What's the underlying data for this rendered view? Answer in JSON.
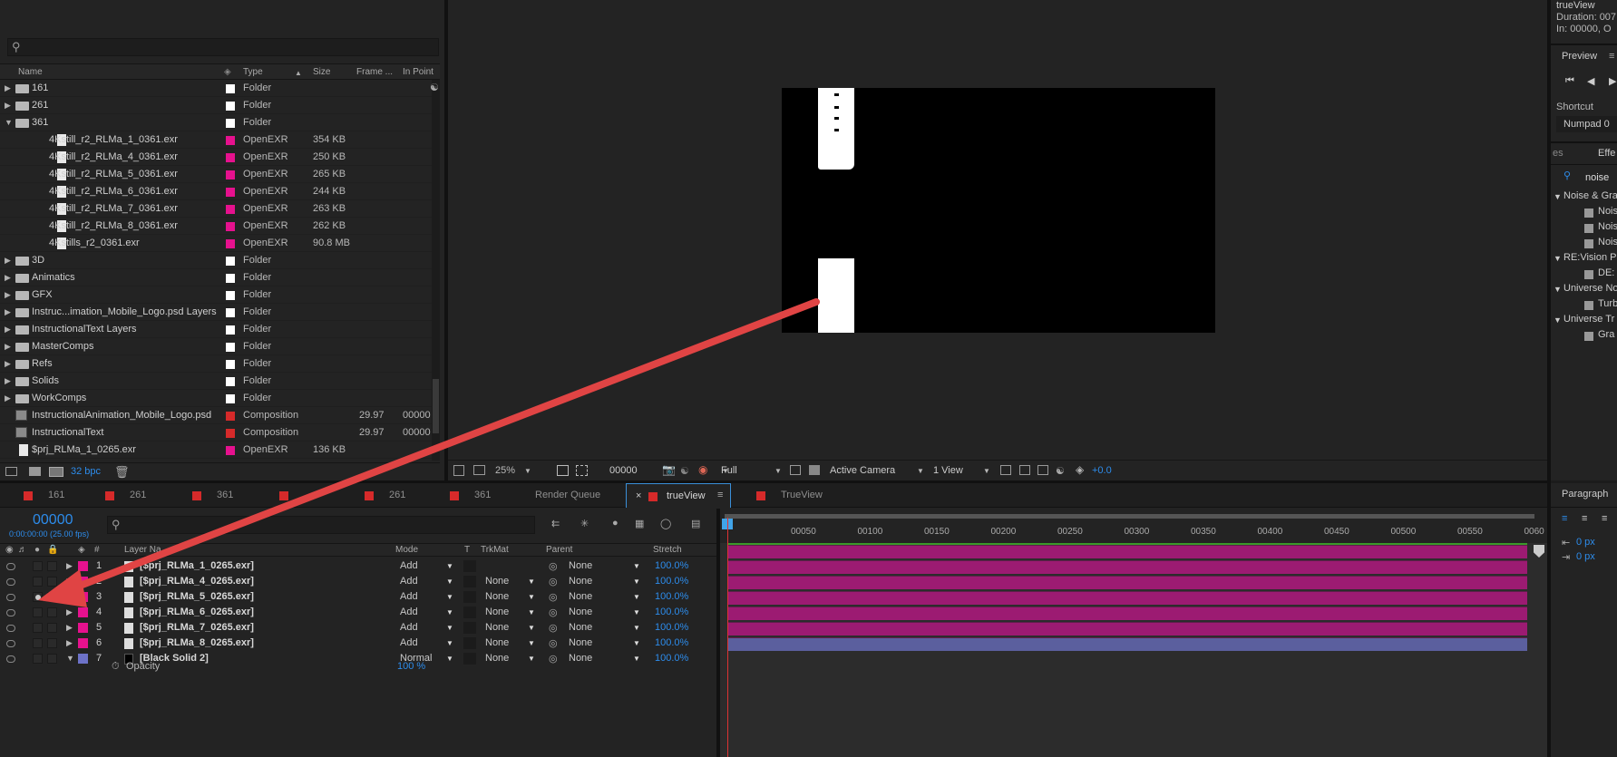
{
  "colors": {
    "accent_blue": "#2d8ceb",
    "label_pink": "#e6118e",
    "label_red": "#d62a2a",
    "label_white": "#ffffff",
    "label_purple": "#6d72c8",
    "clip_magenta": "#9c1b72",
    "clip_purple": "#5b5f9e",
    "annotation_arrow": "#e04444"
  },
  "right_panel": {
    "comp_name": "trueView",
    "duration": "Duration: 007",
    "in_point": "In: 00000, O",
    "preview_title": "Preview",
    "shortcut_label": "Shortcut",
    "shortcut_value": "Numpad 0",
    "effects_tab_left": "es",
    "effects_tab_right": "Effe",
    "effects_search": "noise",
    "effects_tree": [
      {
        "label": "Noise & Gra",
        "kind": "group"
      },
      {
        "label": "Nois",
        "kind": "item"
      },
      {
        "label": "Nois",
        "kind": "item"
      },
      {
        "label": "Nois",
        "kind": "item"
      },
      {
        "label": "RE:Vision Pl",
        "kind": "group"
      },
      {
        "label": "DE:",
        "kind": "item"
      },
      {
        "label": "Universe No",
        "kind": "group"
      },
      {
        "label": "Turb",
        "kind": "item"
      },
      {
        "label": "Universe Tr",
        "kind": "group"
      },
      {
        "label": "Gra",
        "kind": "item"
      }
    ],
    "paragraph_title": "Paragraph",
    "para_val1": "0 px",
    "para_val2": "0 px"
  },
  "project": {
    "headers": {
      "name": "Name",
      "type": "Type",
      "size": "Size",
      "frame": "Frame ...",
      "in_point": "In Point"
    },
    "rows": [
      {
        "indent": 0,
        "kind": "folder",
        "open": false,
        "name": "161",
        "label": "white",
        "type": "Folder",
        "size": "",
        "frame": "",
        "inpt": ""
      },
      {
        "indent": 0,
        "kind": "folder",
        "open": false,
        "name": "261",
        "label": "white",
        "type": "Folder",
        "size": "",
        "frame": "",
        "inpt": ""
      },
      {
        "indent": 0,
        "kind": "folder",
        "open": true,
        "name": "361",
        "label": "white",
        "type": "Folder",
        "size": "",
        "frame": "",
        "inpt": ""
      },
      {
        "indent": 1,
        "kind": "file",
        "name": "4Kstill_r2_RLMa_1_0361.exr",
        "label": "pink",
        "type": "OpenEXR",
        "size": "354 KB",
        "frame": "",
        "inpt": ""
      },
      {
        "indent": 1,
        "kind": "file",
        "name": "4Kstill_r2_RLMa_4_0361.exr",
        "label": "pink",
        "type": "OpenEXR",
        "size": "250 KB",
        "frame": "",
        "inpt": ""
      },
      {
        "indent": 1,
        "kind": "file",
        "name": "4Kstill_r2_RLMa_5_0361.exr",
        "label": "pink",
        "type": "OpenEXR",
        "size": "265 KB",
        "frame": "",
        "inpt": ""
      },
      {
        "indent": 1,
        "kind": "file",
        "name": "4Kstill_r2_RLMa_6_0361.exr",
        "label": "pink",
        "type": "OpenEXR",
        "size": "244 KB",
        "frame": "",
        "inpt": ""
      },
      {
        "indent": 1,
        "kind": "file",
        "name": "4Kstill_r2_RLMa_7_0361.exr",
        "label": "pink",
        "type": "OpenEXR",
        "size": "263 KB",
        "frame": "",
        "inpt": ""
      },
      {
        "indent": 1,
        "kind": "file",
        "name": "4Kstill_r2_RLMa_8_0361.exr",
        "label": "pink",
        "type": "OpenEXR",
        "size": "262 KB",
        "frame": "",
        "inpt": ""
      },
      {
        "indent": 1,
        "kind": "file",
        "name": "4Kstills_r2_0361.exr",
        "label": "pink",
        "type": "OpenEXR",
        "size": "90.8 MB",
        "frame": "",
        "inpt": ""
      },
      {
        "indent": 0,
        "kind": "folder",
        "open": false,
        "name": "3D",
        "label": "white",
        "type": "Folder",
        "size": "",
        "frame": "",
        "inpt": ""
      },
      {
        "indent": 0,
        "kind": "folder",
        "open": false,
        "name": "Animatics",
        "label": "white",
        "type": "Folder",
        "size": "",
        "frame": "",
        "inpt": ""
      },
      {
        "indent": 0,
        "kind": "folder",
        "open": false,
        "name": "GFX",
        "label": "white",
        "type": "Folder",
        "size": "",
        "frame": "",
        "inpt": ""
      },
      {
        "indent": 0,
        "kind": "folder",
        "open": false,
        "name": "Instruc...imation_Mobile_Logo.psd Layers",
        "label": "white",
        "type": "Folder",
        "size": "",
        "frame": "",
        "inpt": ""
      },
      {
        "indent": 0,
        "kind": "folder",
        "open": false,
        "name": "InstructionalText Layers",
        "label": "white",
        "type": "Folder",
        "size": "",
        "frame": "",
        "inpt": ""
      },
      {
        "indent": 0,
        "kind": "folder",
        "open": false,
        "name": "MasterComps",
        "label": "white",
        "type": "Folder",
        "size": "",
        "frame": "",
        "inpt": ""
      },
      {
        "indent": 0,
        "kind": "folder",
        "open": false,
        "name": "Refs",
        "label": "white",
        "type": "Folder",
        "size": "",
        "frame": "",
        "inpt": ""
      },
      {
        "indent": 0,
        "kind": "folder",
        "open": false,
        "name": "Solids",
        "label": "white",
        "type": "Folder",
        "size": "",
        "frame": "",
        "inpt": ""
      },
      {
        "indent": 0,
        "kind": "folder",
        "open": false,
        "name": "WorkComps",
        "label": "white",
        "type": "Folder",
        "size": "",
        "frame": "",
        "inpt": ""
      },
      {
        "indent": 0,
        "kind": "comp",
        "name": "InstructionalAnimation_Mobile_Logo.psd",
        "label": "red",
        "type": "Composition",
        "size": "",
        "frame": "29.97",
        "inpt": "00000"
      },
      {
        "indent": 0,
        "kind": "comp",
        "name": "InstructionalText",
        "label": "red",
        "type": "Composition",
        "size": "",
        "frame": "29.97",
        "inpt": "00000"
      },
      {
        "indent": 0,
        "kind": "file",
        "name": "$prj_RLMa_1_0265.exr",
        "label": "pink",
        "type": "OpenEXR",
        "size": "136 KB",
        "frame": "",
        "inpt": ""
      }
    ],
    "bpc": "32 bpc"
  },
  "viewer_bar": {
    "zoom": "25%",
    "timecode": "00000",
    "resolution": "Full",
    "camera": "Active Camera",
    "views": "1 View",
    "exposure": "+0.0"
  },
  "timeline": {
    "tabs": [
      {
        "label": "161",
        "active": false
      },
      {
        "label": "261",
        "active": false
      },
      {
        "label": "361",
        "active": false
      },
      {
        "label": "",
        "active": false
      },
      {
        "label": "261",
        "active": false
      },
      {
        "label": "361",
        "active": false
      },
      {
        "label": "Render Queue",
        "active": false,
        "noswatch": true
      },
      {
        "label": "trueView",
        "active": true
      },
      {
        "label": "TrueView",
        "active": false
      }
    ],
    "timecode": "00000",
    "fps": "0:00:00:00 (25.00 fps)",
    "headers": {
      "num": "#",
      "layer": "Layer Na",
      "mode": "Mode",
      "t": "T",
      "trkmat": "TrkMat",
      "parent": "Parent",
      "stretch": "Stretch"
    },
    "layers": [
      {
        "num": "1",
        "name": "[$prj_RLMa_1_0265.exr]",
        "label": "pink",
        "mode": "Add",
        "trkmat": "",
        "parent": "None",
        "stretch": "100.0%",
        "bar": "magenta"
      },
      {
        "num": "2",
        "name": "[$prj_RLMa_4_0265.exr]",
        "label": "pink",
        "mode": "Add",
        "trkmat": "None",
        "parent": "None",
        "stretch": "100.0%",
        "bar": "magenta"
      },
      {
        "num": "3",
        "name": "[$prj_RLMa_5_0265.exr]",
        "label": "pink",
        "mode": "Add",
        "trkmat": "None",
        "parent": "None",
        "stretch": "100.0%",
        "bar": "magenta",
        "solo": true
      },
      {
        "num": "4",
        "name": "[$prj_RLMa_6_0265.exr]",
        "label": "pink",
        "mode": "Add",
        "trkmat": "None",
        "parent": "None",
        "stretch": "100.0%",
        "bar": "magenta"
      },
      {
        "num": "5",
        "name": "[$prj_RLMa_7_0265.exr]",
        "label": "pink",
        "mode": "Add",
        "trkmat": "None",
        "parent": "None",
        "stretch": "100.0%",
        "bar": "magenta"
      },
      {
        "num": "6",
        "name": "[$prj_RLMa_8_0265.exr]",
        "label": "pink",
        "mode": "Add",
        "trkmat": "None",
        "parent": "None",
        "stretch": "100.0%",
        "bar": "magenta"
      },
      {
        "num": "7",
        "name": "[Black Solid 2]",
        "label": "purple",
        "mode": "Normal",
        "trkmat": "None",
        "parent": "None",
        "stretch": "100.0%",
        "bar": "purple",
        "open": true
      }
    ],
    "opacity_label": "Opacity",
    "opacity_value": "100 %",
    "ruler": [
      "00050",
      "00100",
      "00150",
      "00200",
      "00250",
      "00300",
      "00350",
      "00400",
      "00450",
      "00500",
      "00550",
      "0060"
    ]
  }
}
